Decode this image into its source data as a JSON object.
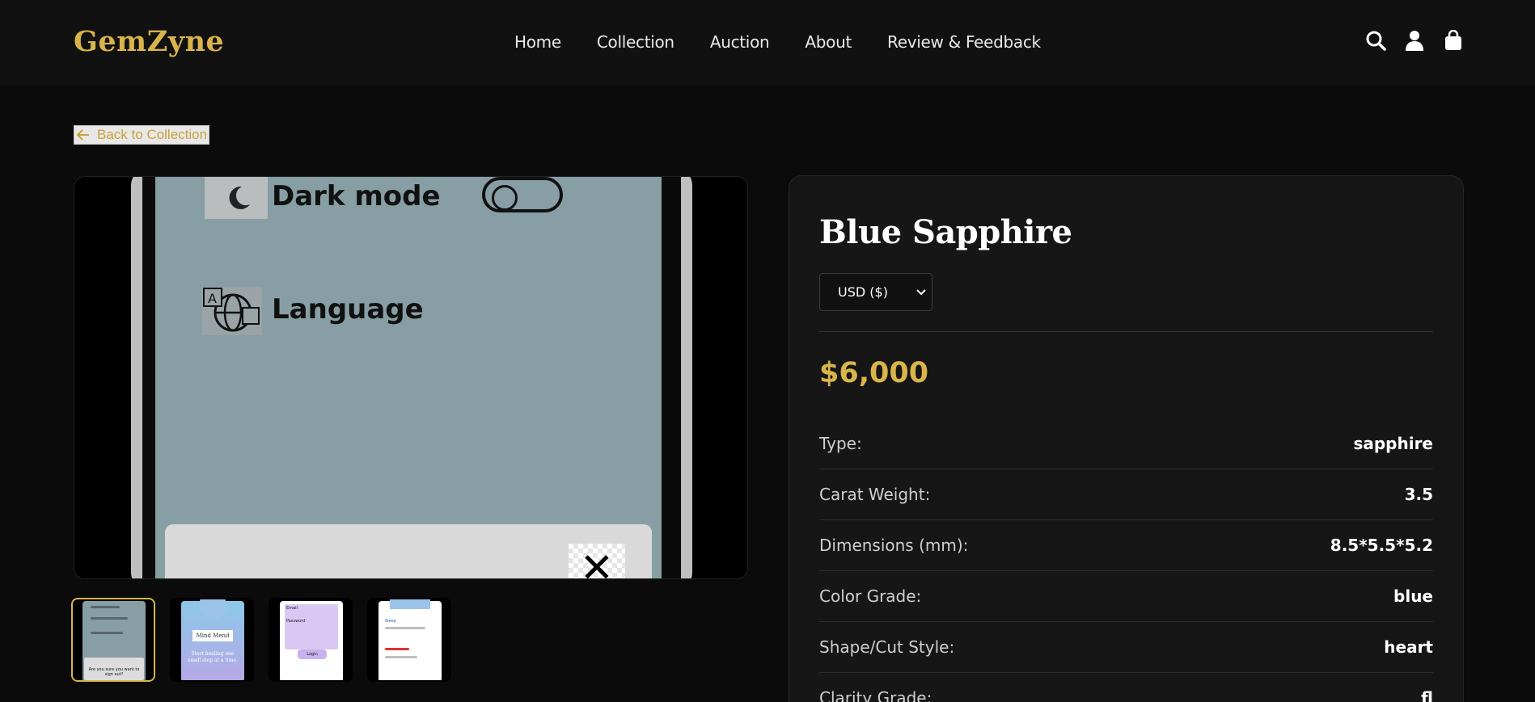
{
  "header": {
    "logo": "GemZyne",
    "nav": [
      "Home",
      "Collection",
      "Auction",
      "About",
      "Review & Feedback"
    ],
    "icons": [
      "search-icon",
      "user-icon",
      "shopping-bag-icon"
    ]
  },
  "back_link": {
    "label": "Back to Collection",
    "icon": "arrow-left-icon"
  },
  "main_image": {
    "rows": [
      {
        "label": "Dark mode",
        "icon": "moon-icon"
      },
      {
        "label": "Language",
        "icon": "translate-globe-icon"
      }
    ],
    "close_icon": "close-icon"
  },
  "thumbnails": {
    "count": 4,
    "active_index": 0,
    "items": [
      {
        "caption": "Are you sure you want to sign out?"
      },
      {
        "caption": "Mind Mend",
        "subcaption": "Start healing one small step at a time."
      },
      {
        "caption": "Login",
        "fields": [
          "Email",
          "Password"
        ]
      },
      {
        "caption": "Sleep"
      }
    ]
  },
  "product": {
    "name": "Blue Sapphire",
    "currency": "USD ($)",
    "price": "$6,000",
    "specs": [
      {
        "label": "Type:",
        "value": "sapphire"
      },
      {
        "label": "Carat Weight:",
        "value": "3.5"
      },
      {
        "label": "Dimensions (mm):",
        "value": "8.5*5.5*5.2"
      },
      {
        "label": "Color Grade:",
        "value": "blue"
      },
      {
        "label": "Shape/Cut Style:",
        "value": "heart"
      },
      {
        "label": "Clarity Grade:",
        "value": "fl"
      }
    ]
  },
  "colors": {
    "accent": "#d8b44a",
    "background": "#0b0b0b",
    "panel": "#161616"
  }
}
